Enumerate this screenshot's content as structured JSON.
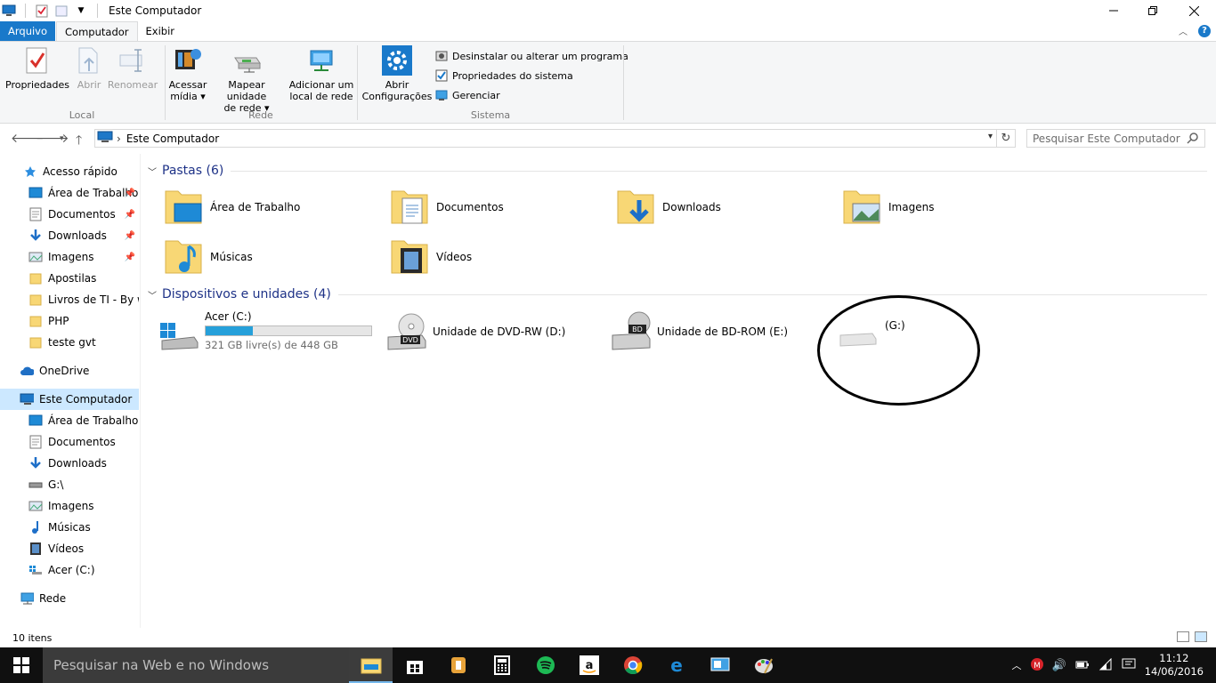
{
  "window": {
    "title": "Este Computador"
  },
  "tabs": {
    "file": "Arquivo",
    "computer": "Computador",
    "view": "Exibir"
  },
  "ribbon": {
    "local": {
      "label": "Local",
      "properties": "Propriedades",
      "open": "Abrir",
      "rename": "Renomear"
    },
    "network": {
      "label": "Rede",
      "access_media_1": "Acessar",
      "access_media_2": "mídia",
      "map_drive_1": "Mapear unidade",
      "map_drive_2": "de rede",
      "add_location_1": "Adicionar um",
      "add_location_2": "local de rede"
    },
    "system": {
      "label": "Sistema",
      "open_settings_1": "Abrir",
      "open_settings_2": "Configurações",
      "uninstall": "Desinstalar ou alterar um programa",
      "sys_props": "Propriedades do sistema",
      "manage": "Gerenciar"
    }
  },
  "address": {
    "path": "Este Computador",
    "search_placeholder": "Pesquisar Este Computador"
  },
  "nav": {
    "quick_access": "Acesso rápido",
    "qa_items": [
      "Área de Trabalho",
      "Documentos",
      "Downloads",
      "Imagens",
      "Apostilas",
      "Livros de TI - By wh",
      "PHP",
      "teste gvt"
    ],
    "onedrive": "OneDrive",
    "this_pc": "Este Computador",
    "pc_items": [
      "Área de Trabalho",
      "Documentos",
      "Downloads",
      "G:\\",
      "Imagens",
      "Músicas",
      "Vídeos",
      "Acer (C:)"
    ],
    "network": "Rede"
  },
  "content": {
    "folders_header": "Pastas (6)",
    "folders": [
      "Área de Trabalho",
      "Documentos",
      "Downloads",
      "Imagens",
      "Músicas",
      "Vídeos"
    ],
    "devices_header": "Dispositivos e unidades (4)",
    "drives": [
      {
        "name": "Acer (C:)",
        "free": "321 GB livre(s) de 448 GB",
        "used_fraction": 0.283
      },
      {
        "name": "Unidade de DVD-RW (D:)"
      },
      {
        "name": "Unidade de BD-ROM (E:)"
      },
      {
        "name": "(G:)"
      }
    ]
  },
  "status": {
    "items": "10 itens"
  },
  "taskbar": {
    "search": "Pesquisar na Web e no Windows",
    "time": "11:12",
    "date": "14/06/2016"
  },
  "colors": {
    "accent": "#1979ca",
    "selected": "#cce8ff",
    "drive_bar": "#26a0da",
    "header_text": "#1e3287"
  }
}
